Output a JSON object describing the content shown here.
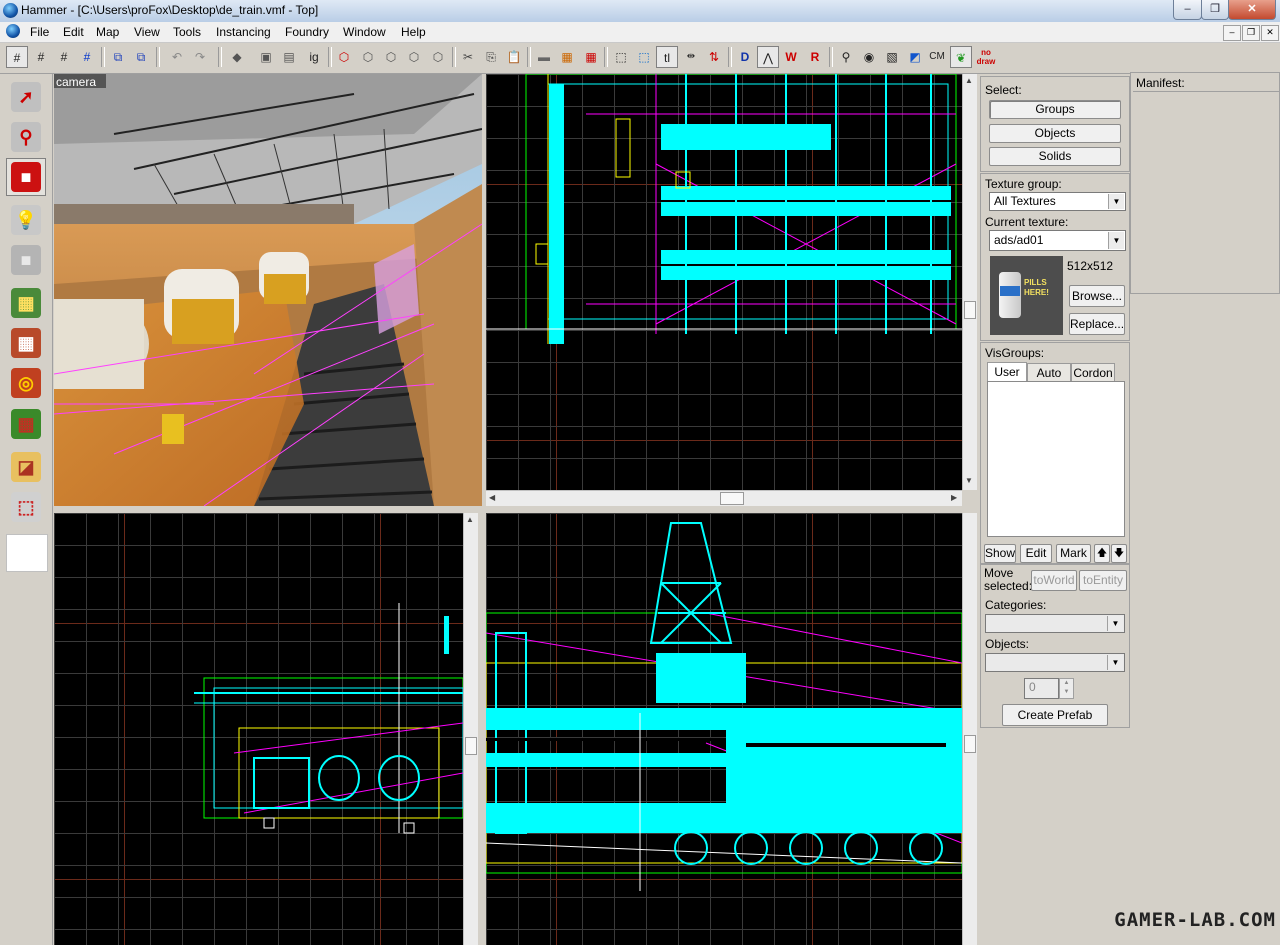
{
  "window": {
    "title": "Hammer - [C:\\Users\\proFox\\Desktop\\de_train.vmf - Top]",
    "controls": [
      "–",
      "❐",
      "✕"
    ]
  },
  "menu": {
    "items": [
      "File",
      "Edit",
      "Map",
      "View",
      "Tools",
      "Instancing",
      "Foundry",
      "Window",
      "Help"
    ],
    "mdi_controls": [
      "–",
      "❐",
      "✕"
    ]
  },
  "toolbar": {
    "ignore_groups_label": "ig",
    "texture_lock_label": "tl",
    "cordon_label": "CM",
    "nodraw_label": "no draw"
  },
  "viewports": {
    "camera_label": "camera"
  },
  "select_panel": {
    "heading": "Select:",
    "groups": "Groups",
    "objects": "Objects",
    "solids": "Solids"
  },
  "manifest": {
    "heading": "Manifest:"
  },
  "texture_panel": {
    "group_label": "Texture group:",
    "group_value": "All Textures",
    "current_label": "Current texture:",
    "current_value": "ads/ad01",
    "size": "512x512",
    "browse": "Browse...",
    "replace": "Replace...",
    "thumb_text": "PILLS HERE!"
  },
  "visgroups": {
    "heading": "VisGroups:",
    "tabs": [
      "User",
      "Auto",
      "Cordon"
    ],
    "show": "Show",
    "edit": "Edit",
    "mark": "Mark",
    "up": "🡅",
    "down": "🡇"
  },
  "move_panel": {
    "label": "Move selected:",
    "to_world": "toWorld",
    "to_entity": "toEntity"
  },
  "prefab_panel": {
    "categories_label": "Categories:",
    "objects_label": "Objects:",
    "spinner_value": "0",
    "create": "Create Prefab"
  },
  "watermark": "GAMER-LAB.COM",
  "colors": {
    "cyan_brush": "#00ffff",
    "magenta_entity": "#ff00ff",
    "yellow_selection": "#ffff00",
    "green_wire": "#00ff00",
    "grid_major": "#6b2a1a"
  }
}
